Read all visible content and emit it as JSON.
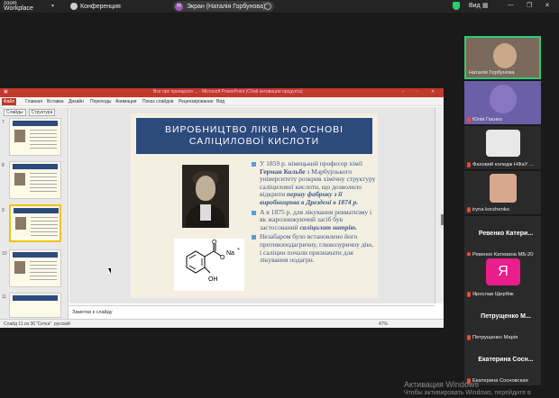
{
  "topbar": {
    "logo_line1": "zoom",
    "logo_line2": "Workplace",
    "meeting_label": "Конференция",
    "share_label": "Экран (Наталія Горбунова)",
    "share_avatar": "Н",
    "view_label": "Вид"
  },
  "ppt": {
    "window_title": "Все про препарати ... - Microsoft PowerPoint (Сбой активации продукта)",
    "file_tab": "Файл",
    "ribbon_tabs": [
      "Главная",
      "Вставка",
      "Дизайн",
      "Переходы",
      "Анимация",
      "Показ слайдов",
      "Рецензирование",
      "Вид"
    ],
    "pane_tabs": [
      "Слайды",
      "Структура"
    ],
    "thumb_numbers": [
      "7",
      "8",
      "9",
      "10",
      "11"
    ],
    "notes_placeholder": "Заметки к слайду",
    "status_left": "Слайд 11 из 36",
    "status_theme": "\"Сетка\"",
    "status_lang": "русский",
    "zoom_level": "47%"
  },
  "slide": {
    "title_line1": "ВИРОБНИЦТВО ЛІКІВ НА ОСНОВІ",
    "title_line2": "САЛІЦИЛОВОЇ КИСЛОТИ",
    "molecule_na": "Na",
    "molecule_plus": "+",
    "molecule_oh": "OH",
    "molecule_o1": "O",
    "molecule_o2": "O",
    "bullet1_a": "У 1859 р. німецький професор хімії ",
    "bullet1_name": "Герман Кольбе",
    "bullet1_b": " з Марбурзького університету розкрив хімічну структуру саліцилової кислоти, що дозволило відкрити ",
    "bullet1_em": "першу фабрику з її виробництва в Дрездені в 1874 р.",
    "bullet2_a": "А в 1875 р. для лікування ревматизму і як жарознижуючий засіб був застосований ",
    "bullet2_em": "саліцилат натрію.",
    "bullet3": "Незабаром було встановлено його противоподагричну, глюкозуричну дію, і саліцин почали призначати для лікування подагри."
  },
  "participants": [
    {
      "name": "Наталія Горбунова",
      "type": "video"
    },
    {
      "name": "Юлія Гоєнко",
      "type": "video"
    },
    {
      "name": "Фаховий коледж НФаУ ...",
      "type": "image"
    },
    {
      "name": "iryna korzhenko",
      "type": "video"
    },
    {
      "name": "Ревенко Катерина МБ-20",
      "display": "Ревенко Катери...",
      "type": "name"
    },
    {
      "name": "Ярослав Щербяк",
      "avatar_letter": "Я",
      "avatar_color": "#e91e8c",
      "type": "avatar"
    },
    {
      "name": "Петрущенко Марія",
      "display": "Петрущенко М...",
      "type": "name"
    },
    {
      "name": "Екатерина Сосновская",
      "display": "Екатерина Сосн...",
      "type": "name"
    }
  ],
  "watermark": {
    "line1": "Активация Windows",
    "line2": "Чтобы активировать Windows, перейдите в"
  }
}
